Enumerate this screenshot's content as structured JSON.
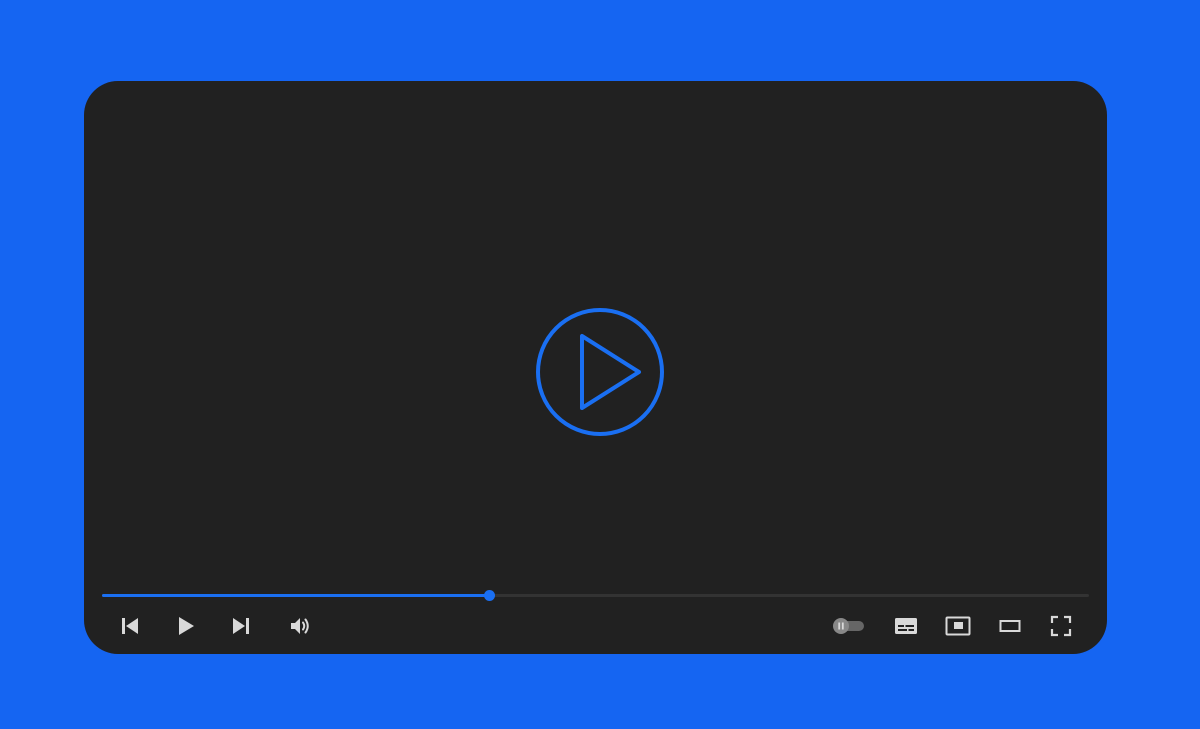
{
  "player": {
    "progress_fraction": 0.392,
    "colors": {
      "page_background": "#1565F2",
      "player_background": "#212121",
      "accent": "#1A6FF2",
      "icon": "#D9D9D9",
      "track": "#333333"
    },
    "controls": {
      "left": [
        "skip-previous-icon",
        "play-icon",
        "skip-next-icon",
        "volume-icon"
      ],
      "right": [
        "autoplay-toggle-icon",
        "subtitles-icon",
        "miniplayer-icon",
        "theater-mode-icon",
        "fullscreen-icon"
      ]
    },
    "autoplay_on": false
  }
}
